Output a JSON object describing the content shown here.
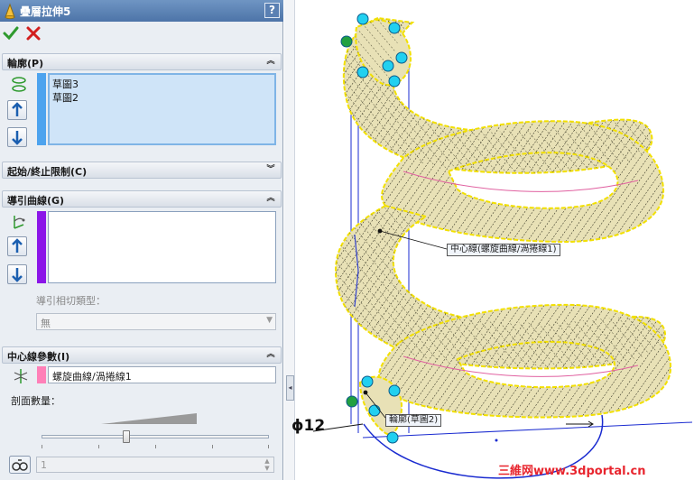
{
  "title": {
    "text": "疊層拉伸5",
    "help": "?"
  },
  "actions": {
    "ok_icon": "check-icon",
    "cancel_icon": "x-icon"
  },
  "profiles": {
    "header": "輪廓(P)",
    "items": [
      "草圖3",
      "草圖2"
    ],
    "strip_color": "#4da3ee"
  },
  "constraints": {
    "header": "起始/終止限制(C)"
  },
  "guides": {
    "header": "導引曲線(G)",
    "strip_color": "#8b16e8",
    "tangency_label": "導引相切類型：",
    "tangency_value": "無"
  },
  "centerline": {
    "header": "中心線參數(I)",
    "strip_color": "#ff80b8",
    "value": "螺旋曲線/渦捲線1",
    "sections_label": "剖面數量：",
    "sections_value": "1"
  },
  "viewport": {
    "callout_centerline": "中心線(螺旋曲線/渦捲線1)",
    "callout_profile": "輪廓(草圖2)",
    "dimension": "ϕ12"
  },
  "watermark": "三維网www.3dportal.cn",
  "colors": {
    "title_bar": "#5a80b3",
    "panel_bg": "#eaeef3",
    "ok_green": "#2e9a2e",
    "cancel_red": "#d21f1f",
    "handle_cyan": "#22d0f0",
    "handle_green": "#22a040",
    "surface": "#e6dfb0",
    "selection_yellow": "#f2e000"
  }
}
